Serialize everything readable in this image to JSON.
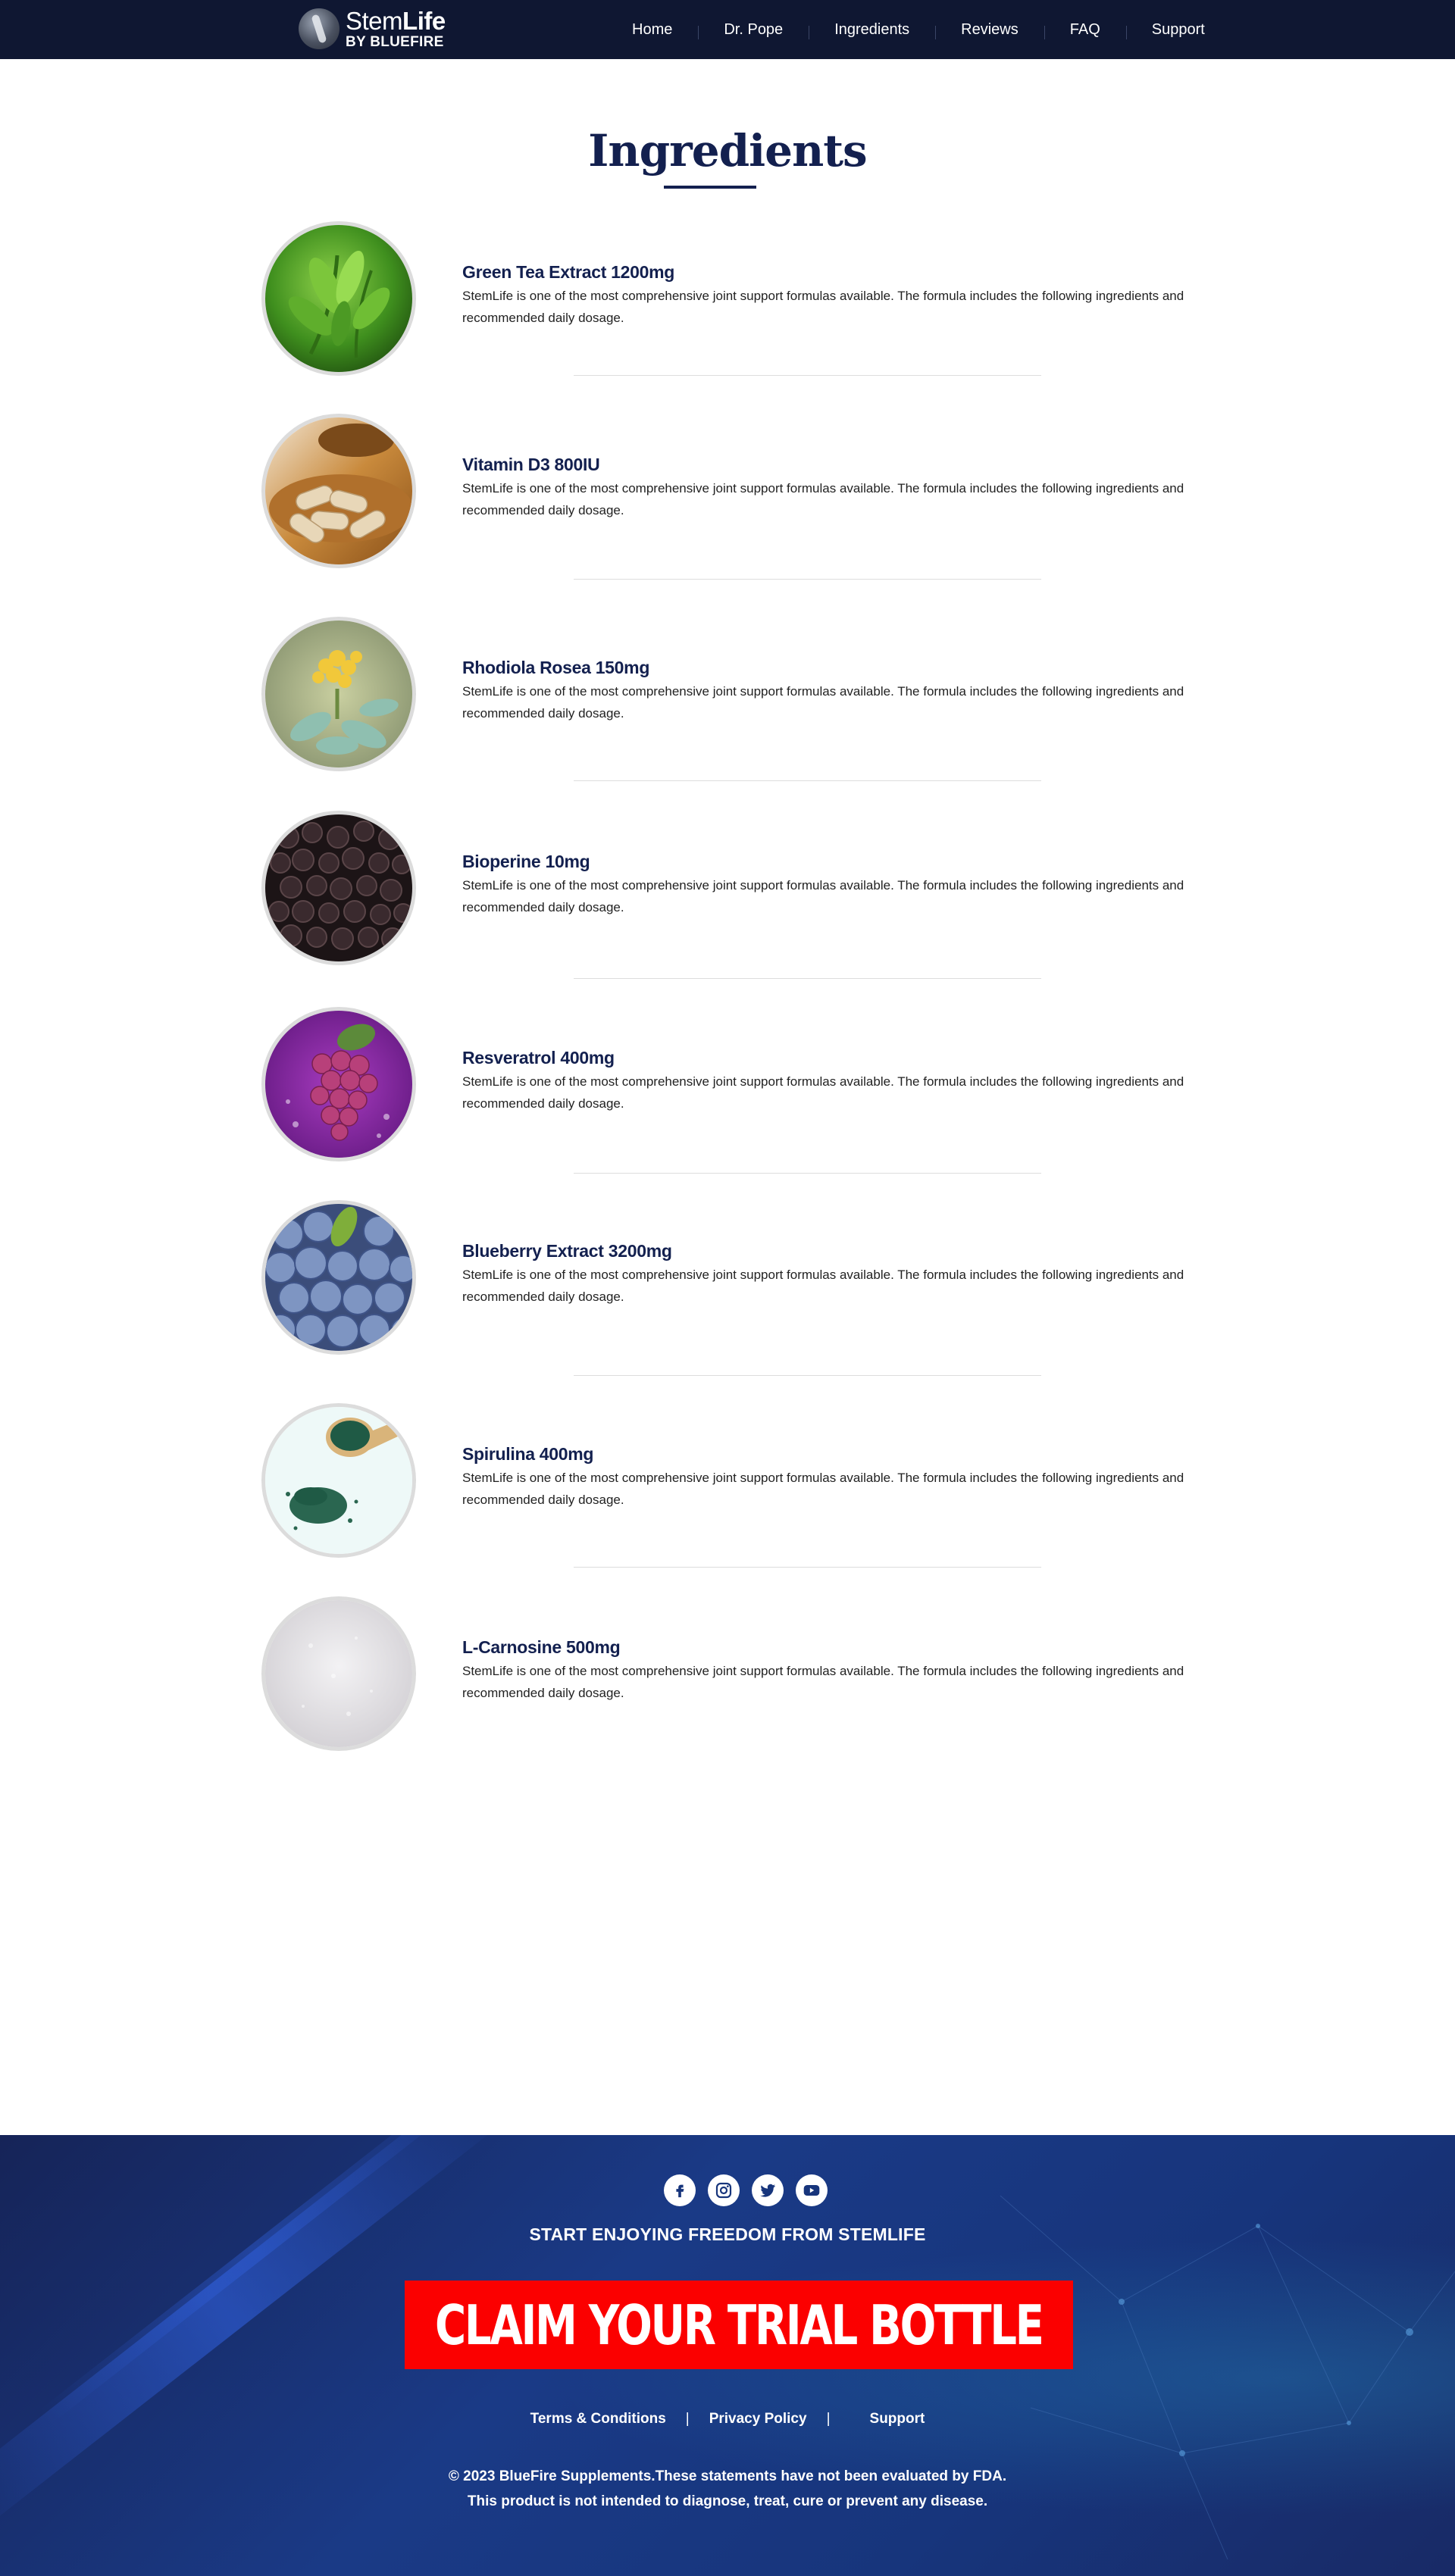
{
  "header": {
    "logo": {
      "brand_light": "Stem",
      "brand_bold": "Life",
      "byline": "BY BLUEFIRE"
    },
    "nav": [
      "Home",
      "Dr. Pope",
      "Ingredients",
      "Reviews",
      "FAQ",
      "Support"
    ]
  },
  "main": {
    "title": "Ingredients",
    "ingredients": [
      {
        "name": "Green Tea Extract 1200mg",
        "description": "StemLife is one of the most comprehensive joint support formulas available. The formula includes the following ingredients and recommended daily dosage."
      },
      {
        "name": "Vitamin D3 800IU",
        "description": "StemLife is one of the most comprehensive joint support formulas available. The formula includes the following ingredients and recommended daily dosage."
      },
      {
        "name": "Rhodiola Rosea 150mg",
        "description": "StemLife is one of the most comprehensive joint support formulas available. The formula includes the following ingredients and recommended daily dosage."
      },
      {
        "name": "Bioperine 10mg",
        "description": "StemLife is one of the most comprehensive joint support formulas available. The formula includes the following ingredients and recommended daily dosage."
      },
      {
        "name": "Resveratrol 400mg",
        "description": "StemLife is one of the most comprehensive joint support formulas available. The formula includes the following ingredients and recommended daily dosage."
      },
      {
        "name": "Blueberry Extract 3200mg",
        "description": "StemLife is one of the most comprehensive joint support formulas available. The formula includes the following ingredients and recommended daily dosage."
      },
      {
        "name": "Spirulina 400mg",
        "description": "StemLife is one of the most comprehensive joint support formulas available. The formula includes the following ingredients and recommended daily dosage."
      },
      {
        "name": "L-Carnosine 500mg",
        "description": "StemLife is one of the most comprehensive joint support formulas available. The formula includes the following ingredients and recommended daily dosage."
      }
    ]
  },
  "footer": {
    "social_icons": [
      "facebook-icon",
      "instagram-icon",
      "twitter-icon",
      "youtube-icon"
    ],
    "tagline": "START ENJOYING FREEDOM FROM STEMLIFE",
    "cta": "CLAIM YOUR TRIAL BOTTLE",
    "links": [
      "Terms & Conditions",
      "Privacy Policy",
      "Support"
    ],
    "copyright_line1": "© 2023 BlueFire Supplements.These statements have not been evaluated by FDA.",
    "copyright_line2": "This product is not intended to diagnose, treat, cure or prevent any disease."
  },
  "colors": {
    "header_bg": "#0f1732",
    "title": "#13204f",
    "cta_bg": "#fb0000",
    "footer_bg": "#17357c"
  }
}
